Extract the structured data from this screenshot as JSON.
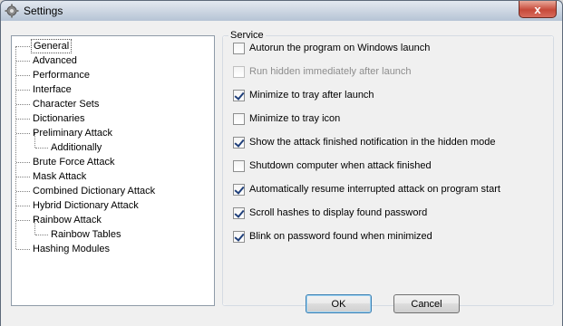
{
  "window": {
    "title": "Settings",
    "close_glyph": "x"
  },
  "tree": {
    "items": [
      {
        "label": "General",
        "level": 0,
        "selected": true
      },
      {
        "label": "Advanced",
        "level": 0
      },
      {
        "label": "Performance",
        "level": 0
      },
      {
        "label": "Interface",
        "level": 0
      },
      {
        "label": "Character Sets",
        "level": 0
      },
      {
        "label": "Dictionaries",
        "level": 0
      },
      {
        "label": "Preliminary Attack",
        "level": 0
      },
      {
        "label": "Additionally",
        "level": 1
      },
      {
        "label": "Brute Force Attack",
        "level": 0
      },
      {
        "label": "Mask Attack",
        "level": 0
      },
      {
        "label": "Combined Dictionary Attack",
        "level": 0
      },
      {
        "label": "Hybrid Dictionary Attack",
        "level": 0
      },
      {
        "label": "Rainbow Attack",
        "level": 0
      },
      {
        "label": "Rainbow Tables",
        "level": 1
      },
      {
        "label": "Hashing Modules",
        "level": 0
      }
    ]
  },
  "service": {
    "group_label": "Service",
    "options": [
      {
        "label": "Autorun the program on Windows launch",
        "checked": false,
        "disabled": false
      },
      {
        "label": "Run hidden immediately after launch",
        "checked": false,
        "disabled": true
      },
      {
        "label": "Minimize to tray after launch",
        "checked": true,
        "disabled": false
      },
      {
        "label": "Minimize to tray icon",
        "checked": false,
        "disabled": false
      },
      {
        "label": "Show the attack finished notification in the hidden mode",
        "checked": true,
        "disabled": false
      },
      {
        "label": "Shutdown computer when attack finished",
        "checked": false,
        "disabled": false
      },
      {
        "label": "Automatically resume interrupted attack on program start",
        "checked": true,
        "disabled": false
      },
      {
        "label": "Scroll hashes to display found password",
        "checked": true,
        "disabled": false
      },
      {
        "label": "Blink on password found when minimized",
        "checked": true,
        "disabled": false
      }
    ]
  },
  "buttons": {
    "ok": "OK",
    "cancel": "Cancel"
  }
}
